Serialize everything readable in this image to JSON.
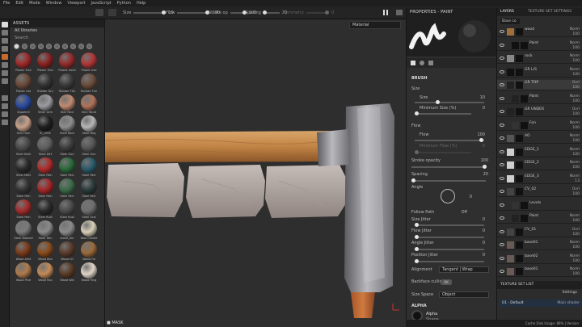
{
  "menu": [
    "File",
    "Edit",
    "Mode",
    "Window",
    "Viewport",
    "JavaScript",
    "Python",
    "Help"
  ],
  "toolbar": {
    "size_label": "Size",
    "size_value": "10",
    "flow_label": "Flow",
    "flow_value": "100",
    "stroke_opacity_label": "Stroke op",
    "stroke_opacity_value": "100",
    "spacing_label": "Spacing",
    "spacing_value": "20",
    "symmetry_label": "Symmetry",
    "symmetry_value": "0"
  },
  "assets": {
    "title": "ASSETS",
    "library": "All libraries",
    "search_placeholder": "Search",
    "items": [
      {
        "name": "Plastic Tran",
        "color": "#a02828"
      },
      {
        "name": "Plastic Tran",
        "color": "#8a2020"
      },
      {
        "name": "Plastic Used",
        "color": "#952a2a"
      },
      {
        "name": "Plastic Use",
        "color": "#b03535"
      },
      {
        "name": "Plastic Lea",
        "color": "#6a4a3a"
      },
      {
        "name": "Rubber Dry",
        "color": "#333333"
      },
      {
        "name": "Rubber Tire",
        "color": "#3a3a3a"
      },
      {
        "name": "Rubber Tire",
        "color": "#6b4c3b"
      },
      {
        "name": "Sapphire",
        "color": "#2a4aa0"
      },
      {
        "name": "Silver Arm",
        "color": "#9a9aa0"
      },
      {
        "name": "Skin Face",
        "color": "#c08a70"
      },
      {
        "name": "Skin Hand",
        "color": "#b0735a"
      },
      {
        "name": "Skin Hum",
        "color": "#c9a089"
      },
      {
        "name": "Sl_c0ffe",
        "color": "#1e1e1e"
      },
      {
        "name": "Steel Bare",
        "color": "#8d8d8d"
      },
      {
        "name": "Steel Brig",
        "color": "#b5b5b5"
      },
      {
        "name": "Steel Dark",
        "color": "#4a4a4a"
      },
      {
        "name": "Steel Dirt",
        "color": "#5e5e5e"
      },
      {
        "name": "Steel Gun",
        "color": "#3c3c3c"
      },
      {
        "name": "Steel Gun",
        "color": "#555555"
      },
      {
        "name": "Steel Matt",
        "color": "#2a2a2a"
      },
      {
        "name": "Steel Pain",
        "color": "#b02a2a"
      },
      {
        "name": "Steel Pain",
        "color": "#2a6a3a"
      },
      {
        "name": "Steel Pain",
        "color": "#2a5a6a"
      },
      {
        "name": "Steel Pain",
        "color": "#333333"
      },
      {
        "name": "Steel Pain",
        "color": "#a52525"
      },
      {
        "name": "Steel Pain",
        "color": "#3a6a48"
      },
      {
        "name": "Steel Pain",
        "color": "#2a3a3a"
      },
      {
        "name": "Steel Pain",
        "color": "#a32a2a"
      },
      {
        "name": "Steel Rust",
        "color": "#2a2a2a"
      },
      {
        "name": "Steel Rust",
        "color": "#4a4a4a"
      },
      {
        "name": "Steel Scal",
        "color": "#6e6e6e"
      },
      {
        "name": "Steel Stained",
        "color": "#7a7a7a"
      },
      {
        "name": "Steel Tarn",
        "color": "#8a8a8a"
      },
      {
        "name": "stone_tile",
        "color": "#8a8a8a"
      },
      {
        "name": "Wax Candle",
        "color": "#d8cfb8"
      },
      {
        "name": "Wood Ame",
        "color": "#7a3a1a"
      },
      {
        "name": "Wood Bea",
        "color": "#8a4a1a"
      },
      {
        "name": "Wood Ch",
        "color": "#5a3a2a"
      },
      {
        "name": "Wood Oa",
        "color": "#9a6a3a"
      },
      {
        "name": "Wood Pine",
        "color": "#b07a4a"
      },
      {
        "name": "Wood Rou",
        "color": "#c48a55"
      },
      {
        "name": "Wood Wal",
        "color": "#5a3a25"
      },
      {
        "name": "Wood Ring",
        "color": "#e0d5c8"
      }
    ]
  },
  "viewport": {
    "mode": "Material",
    "mask_label": "MASK"
  },
  "properties": {
    "title": "PROPERTIES - PAINT",
    "section": "BRUSH",
    "size_label": "Size",
    "size_value": "10",
    "min_size_label": "Minimum Size (%)",
    "min_size_value": "0",
    "flow_label": "Flow",
    "flow_value": "100",
    "min_flow_label": "Minimum Flow (%)",
    "min_flow_value": "0",
    "stroke_opacity_label": "Stroke opacity",
    "stroke_opacity_value": "100",
    "spacing_label": "Spacing",
    "spacing_value": "20",
    "angle_label": "Angle",
    "angle_value": "0",
    "follow_path_label": "Follow Path",
    "follow_path_value": "Off",
    "size_jitter_label": "Size Jitter",
    "size_jitter_value": "0",
    "flow_jitter_label": "Flow Jitter",
    "flow_jitter_value": "0",
    "angle_jitter_label": "Angle Jitter",
    "angle_jitter_value": "0",
    "position_jitter_label": "Position Jitter",
    "position_jitter_value": "0",
    "alignment_label": "Alignment",
    "alignment_value": "Tangent | Wrap",
    "backface_label": "Backface culling",
    "backface_value": "OK",
    "size_space_label": "Size Space",
    "size_space_value": "Object",
    "alpha_section": "ALPHA",
    "alpha_name": "Alpha",
    "alpha_sub": "Shape"
  },
  "layers": {
    "tab_layers": "LAYERS",
    "tab_settings": "TEXTURE SET SETTINGS",
    "blend": "Base co",
    "rows": [
      {
        "name": "wood",
        "blend": "Norm",
        "value": "100",
        "thumb": "#a0703a"
      },
      {
        "name": "Paint",
        "blend": "Norm",
        "value": "100",
        "thumb": "#111111"
      },
      {
        "name": "rock",
        "blend": "Norm",
        "value": "100",
        "thumb": "#888888"
      },
      {
        "name": "GR L/S",
        "blend": "Norm",
        "value": "100",
        "thumb": "#111111"
      },
      {
        "name": "GR TOP",
        "blend": "Ovrl",
        "value": "100",
        "thumb": "#222222"
      },
      {
        "name": "Paint",
        "blend": "Norm",
        "value": "100",
        "thumb": "#222222"
      },
      {
        "name": "GR UNDER",
        "blend": "Ovrl",
        "value": "100",
        "thumb": "#222222"
      },
      {
        "name": "Fon",
        "blend": "Norm",
        "value": "100",
        "thumb": "#333333"
      },
      {
        "name": "AO",
        "blend": "Norm",
        "value": "100",
        "thumb": "#555555"
      },
      {
        "name": "EDGE_1",
        "blend": "Norm",
        "value": "100",
        "thumb": "#cfcfcf"
      },
      {
        "name": "EDGE_2",
        "blend": "Norm",
        "value": "100",
        "thumb": "#cfcfcf"
      },
      {
        "name": "EDGE_3",
        "blend": "Norm",
        "value": "13",
        "thumb": "#cfcfcf"
      },
      {
        "name": "CV_02",
        "blend": "Ovrl",
        "value": "100",
        "thumb": "#444444"
      },
      {
        "name": "Levels",
        "blend": "",
        "value": "",
        "thumb": "#333333"
      },
      {
        "name": "Paint",
        "blend": "Norm",
        "value": "100",
        "thumb": "#222222"
      },
      {
        "name": "CV_01",
        "blend": "Ovrl",
        "value": "100",
        "thumb": "#444444"
      },
      {
        "name": "base01",
        "blend": "Norm",
        "value": "100",
        "thumb": "#6a5a55"
      },
      {
        "name": "base02",
        "blend": "Norm",
        "value": "100",
        "thumb": "#6a5a55"
      },
      {
        "name": "base01",
        "blend": "Norm",
        "value": "100",
        "thumb": "#6a5a55"
      }
    ],
    "texture_set_list_title": "TEXTURE SET LIST",
    "texture_set_settings": "Settings",
    "texture_set_name": "01 - Default",
    "texture_set_shader": "Main shader"
  },
  "status": {
    "text": "Cache Disk Usage: 89% | Version"
  }
}
